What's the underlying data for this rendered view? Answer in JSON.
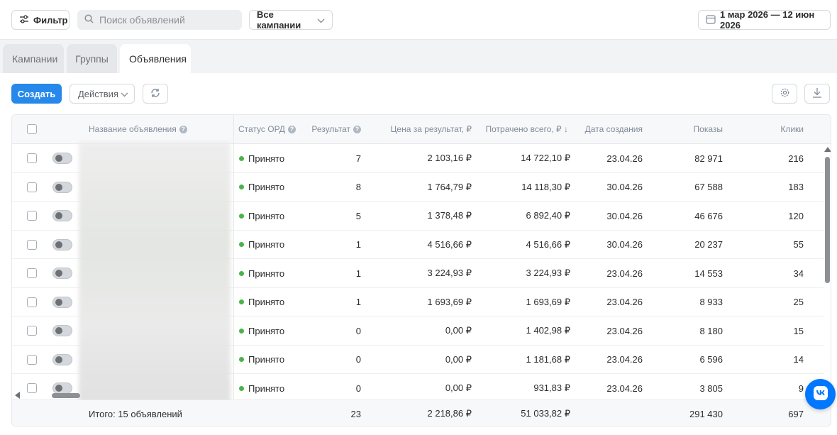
{
  "topbar": {
    "filter_label": "Фильтр",
    "search_placeholder": "Поиск объявлений",
    "campaign_select": "Все кампании",
    "date_range": "1 мар 2026 — 12 июн 2026"
  },
  "tabs": [
    {
      "label": "Кампании",
      "active": false
    },
    {
      "label": "Группы",
      "active": false
    },
    {
      "label": "Объявления",
      "active": true
    }
  ],
  "toolbar": {
    "create_label": "Создать",
    "actions_label": "Действия"
  },
  "table": {
    "headers": {
      "name": "Название объявления",
      "status": "Статус ОРД",
      "result": "Результат",
      "price": "Цена за результат, ₽",
      "spent": "Потрачено всего, ₽ ↓",
      "created": "Дата создания",
      "impressions": "Показы",
      "clicks": "Клики"
    },
    "rows": [
      {
        "status": "Принято",
        "result": "7",
        "price": "2 103,16 ₽",
        "spent": "14 722,10 ₽",
        "created": "23.04.26",
        "impressions": "82 971",
        "clicks": "216"
      },
      {
        "status": "Принято",
        "result": "8",
        "price": "1 764,79 ₽",
        "spent": "14 118,30 ₽",
        "created": "30.04.26",
        "impressions": "67 588",
        "clicks": "183"
      },
      {
        "status": "Принято",
        "result": "5",
        "price": "1 378,48 ₽",
        "spent": "6 892,40 ₽",
        "created": "30.04.26",
        "impressions": "46 676",
        "clicks": "120"
      },
      {
        "status": "Принято",
        "result": "1",
        "price": "4 516,66 ₽",
        "spent": "4 516,66 ₽",
        "created": "30.04.26",
        "impressions": "20 237",
        "clicks": "55"
      },
      {
        "status": "Принято",
        "result": "1",
        "price": "3 224,93 ₽",
        "spent": "3 224,93 ₽",
        "created": "23.04.26",
        "impressions": "14 553",
        "clicks": "34"
      },
      {
        "status": "Принято",
        "result": "1",
        "price": "1 693,69 ₽",
        "spent": "1 693,69 ₽",
        "created": "23.04.26",
        "impressions": "8 933",
        "clicks": "25"
      },
      {
        "status": "Принято",
        "result": "0",
        "price": "0,00 ₽",
        "spent": "1 402,98 ₽",
        "created": "23.04.26",
        "impressions": "8 180",
        "clicks": "15"
      },
      {
        "status": "Принято",
        "result": "0",
        "price": "0,00 ₽",
        "spent": "1 181,68 ₽",
        "created": "23.04.26",
        "impressions": "6 596",
        "clicks": "14"
      },
      {
        "status": "Принято",
        "result": "0",
        "price": "0,00 ₽",
        "spent": "931,83 ₽",
        "created": "23.04.26",
        "impressions": "3 805",
        "clicks": "9"
      }
    ],
    "footer": {
      "total_label": "Итого: 15 объявлений",
      "result": "23",
      "price": "2 218,86 ₽",
      "spent": "51 033,82 ₽",
      "impressions": "291 430",
      "clicks": "697"
    }
  },
  "colors": {
    "accent": "#2688eb",
    "status_ok": "#4bb34b",
    "vk_blue": "#0077ff"
  },
  "icons": [
    "filter-icon",
    "search-icon",
    "chevron-down-icon",
    "calendar-icon",
    "refresh-icon",
    "gear-icon",
    "download-icon",
    "help-icon",
    "vk-logo-icon"
  ]
}
